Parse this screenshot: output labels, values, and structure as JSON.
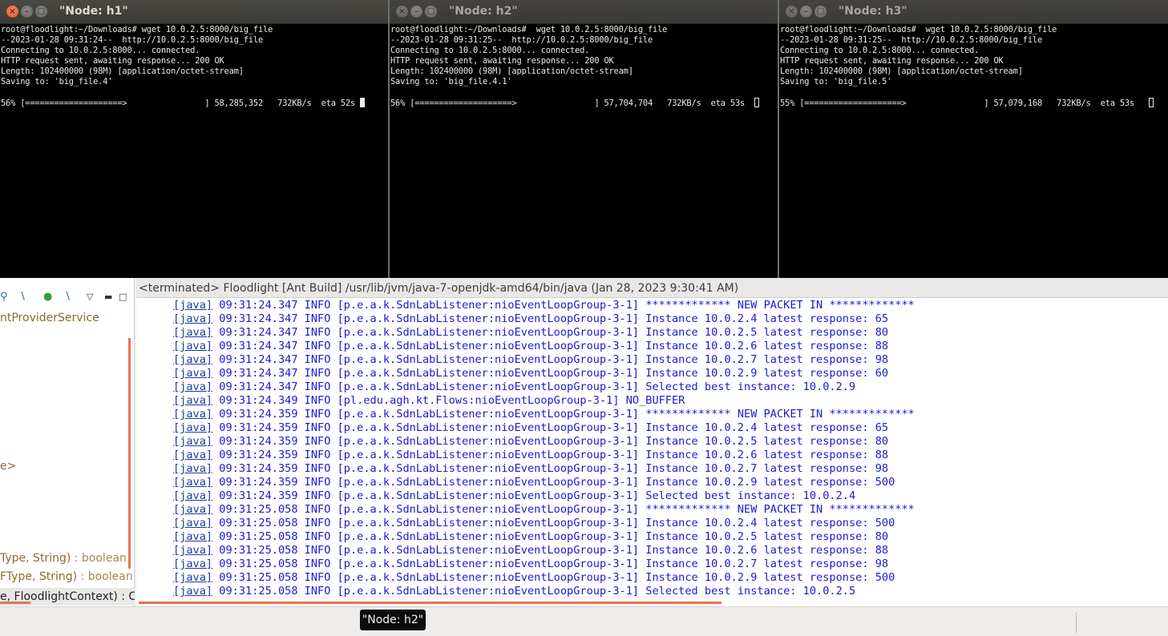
{
  "terminals": [
    {
      "title": "\"Node: h1\"",
      "lines": [
        "root@floodlight:~/Downloads# wget 10.0.2.5:8000/big_file",
        "--2023-01-28 09:31:24--  http://10.0.2.5:8000/big_file",
        "Connecting to 10.0.2.5:8000... connected.",
        "HTTP request sent, awaiting response... 200 OK",
        "Length: 102400000 (98M) [application/octet-stream]",
        "Saving to: 'big_file.4'",
        "",
        "56% [====================>                ] 58,285,352   732KB/s  eta 52s"
      ]
    },
    {
      "title": "\"Node: h2\"",
      "lines": [
        "root@floodlight:~/Downloads#  wget 10.0.2.5:8000/big_file",
        "--2023-01-28 09:31:25--  http://10.0.2.5:8000/big_file",
        "Connecting to 10.0.2.5:8000... connected.",
        "HTTP request sent, awaiting response... 200 OK",
        "Length: 102400000 (98M) [application/octet-stream]",
        "Saving to: 'big_file.4.1'",
        "",
        "56% [====================>                ] 57,704,704   732KB/s  eta 53s"
      ]
    },
    {
      "title": "\"Node: h3\"",
      "lines": [
        "root@floodlight:~/Downloads#  wget 10.0.2.5:8000/big_file",
        "--2023-01-28 09:31:25--  http://10.0.2.5:8000/big_file",
        "Connecting to 10.0.2.5:8000... connected.",
        "HTTP request sent, awaiting response... 200 OK",
        "Length: 102400000 (98M) [application/octet-stream]",
        "Saving to: 'big_file.5'",
        "",
        "55% [====================>                ] 57,079,168   732KB/s  eta 53s"
      ]
    }
  ],
  "outline": {
    "lines": [
      {
        "text": "ntProviderService",
        "rt": ""
      },
      {
        "text": "e>",
        "rt": ""
      },
      {
        "text": "Type, String) ",
        "rt": ": boolean"
      },
      {
        "text": "FType, String) ",
        "rt": ": boolean"
      }
    ],
    "last_line": "e, FloodlightContext) : Co"
  },
  "console": {
    "header": "<terminated> Floodlight [Ant Build] /usr/lib/jvm/java-7-openjdk-amd64/bin/java (Jan 28, 2023 9:30:41 AM)",
    "tag": "[java]",
    "rows": [
      " 09:31:24.347 INFO [p.e.a.k.SdnLabListener:nioEventLoopGroup-3-1] ************* NEW PACKET IN *************",
      " 09:31:24.347 INFO [p.e.a.k.SdnLabListener:nioEventLoopGroup-3-1] Instance 10.0.2.4 latest response: 65",
      " 09:31:24.347 INFO [p.e.a.k.SdnLabListener:nioEventLoopGroup-3-1] Instance 10.0.2.5 latest response: 80",
      " 09:31:24.347 INFO [p.e.a.k.SdnLabListener:nioEventLoopGroup-3-1] Instance 10.0.2.6 latest response: 88",
      " 09:31:24.347 INFO [p.e.a.k.SdnLabListener:nioEventLoopGroup-3-1] Instance 10.0.2.7 latest response: 98",
      " 09:31:24.347 INFO [p.e.a.k.SdnLabListener:nioEventLoopGroup-3-1] Instance 10.0.2.9 latest response: 60",
      " 09:31:24.347 INFO [p.e.a.k.SdnLabListener:nioEventLoopGroup-3-1] Selected best instance: 10.0.2.9",
      " 09:31:24.349 INFO [pl.edu.agh.kt.Flows:nioEventLoopGroup-3-1] NO_BUFFER",
      " 09:31:24.359 INFO [p.e.a.k.SdnLabListener:nioEventLoopGroup-3-1] ************* NEW PACKET IN *************",
      " 09:31:24.359 INFO [p.e.a.k.SdnLabListener:nioEventLoopGroup-3-1] Instance 10.0.2.4 latest response: 65",
      " 09:31:24.359 INFO [p.e.a.k.SdnLabListener:nioEventLoopGroup-3-1] Instance 10.0.2.5 latest response: 80",
      " 09:31:24.359 INFO [p.e.a.k.SdnLabListener:nioEventLoopGroup-3-1] Instance 10.0.2.6 latest response: 88",
      " 09:31:24.359 INFO [p.e.a.k.SdnLabListener:nioEventLoopGroup-3-1] Instance 10.0.2.7 latest response: 98",
      " 09:31:24.359 INFO [p.e.a.k.SdnLabListener:nioEventLoopGroup-3-1] Instance 10.0.2.9 latest response: 500",
      " 09:31:24.359 INFO [p.e.a.k.SdnLabListener:nioEventLoopGroup-3-1] Selected best instance: 10.0.2.4",
      " 09:31:25.058 INFO [p.e.a.k.SdnLabListener:nioEventLoopGroup-3-1] ************* NEW PACKET IN *************",
      " 09:31:25.058 INFO [p.e.a.k.SdnLabListener:nioEventLoopGroup-3-1] Instance 10.0.2.4 latest response: 500",
      " 09:31:25.058 INFO [p.e.a.k.SdnLabListener:nioEventLoopGroup-3-1] Instance 10.0.2.5 latest response: 80",
      " 09:31:25.058 INFO [p.e.a.k.SdnLabListener:nioEventLoopGroup-3-1] Instance 10.0.2.6 latest response: 88",
      " 09:31:25.058 INFO [p.e.a.k.SdnLabListener:nioEventLoopGroup-3-1] Instance 10.0.2.7 latest response: 98",
      " 09:31:25.058 INFO [p.e.a.k.SdnLabListener:nioEventLoopGroup-3-1] Instance 10.0.2.9 latest response: 500",
      " 09:31:25.058 INFO [p.e.a.k.SdnLabListener:nioEventLoopGroup-3-1] Selected best instance: 10.0.2.5"
    ]
  },
  "taskbar": {
    "tooltip": "\"Node: h2\""
  },
  "icons": [
    "close-icon",
    "minimize-icon",
    "maximize-icon",
    "collapse-all-icon",
    "hide-fields-icon",
    "public-members-icon",
    "hide-local-types-icon",
    "view-menu-icon",
    "minimize-view-icon"
  ],
  "colors": {
    "terminal_bg": "#000000",
    "terminal_fg": "#ececec",
    "console_text": "#1a1ad0",
    "accent_orange": "#e8734e",
    "close_button": "#e0542a"
  }
}
